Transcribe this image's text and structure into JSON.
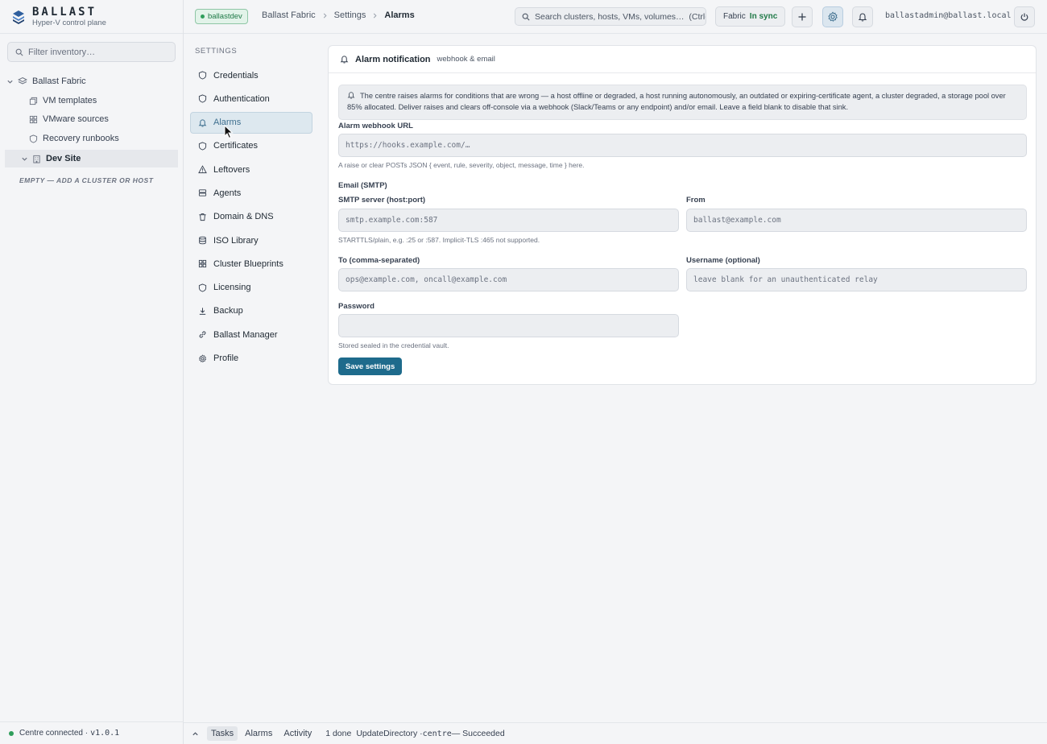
{
  "brand": {
    "name": "BALLAST",
    "subtitle": "Hyper-V control plane"
  },
  "sidebar": {
    "filter_placeholder": "Filter inventory…",
    "tree": [
      {
        "label": "Ballast Fabric",
        "icon": "layers-icon",
        "expanded": true
      },
      {
        "label": "VM templates",
        "icon": "copy-icon"
      },
      {
        "label": "VMware sources",
        "icon": "grid-icon"
      },
      {
        "label": "Recovery runbooks",
        "icon": "shield-icon"
      },
      {
        "label": "Dev Site",
        "icon": "building-icon",
        "expanded": true,
        "selected": true
      }
    ],
    "empty_hint": "EMPTY — ADD A CLUSTER OR HOST",
    "status": "Centre connected · ",
    "version": "v1.0.1"
  },
  "topbar": {
    "env_badge": "ballastdev",
    "breadcrumb": [
      "Ballast Fabric",
      "Settings",
      "Alarms"
    ],
    "search_placeholder": "Search clusters, hosts, VMs, volumes…  (Ctrl-K)",
    "fabric_label": "Fabric",
    "fabric_status": "In sync",
    "user": "ballastadmin@ballast.local"
  },
  "settings_nav": {
    "title": "SETTINGS",
    "items": [
      {
        "label": "Credentials",
        "icon": "shield-icon"
      },
      {
        "label": "Authentication",
        "icon": "shield-icon"
      },
      {
        "label": "Alarms",
        "icon": "bell-icon",
        "active": true
      },
      {
        "label": "Certificates",
        "icon": "shield-icon"
      },
      {
        "label": "Leftovers",
        "icon": "warning-icon"
      },
      {
        "label": "Agents",
        "icon": "server-icon"
      },
      {
        "label": "Domain & DNS",
        "icon": "trash-icon"
      },
      {
        "label": "ISO Library",
        "icon": "database-icon"
      },
      {
        "label": "Cluster Blueprints",
        "icon": "grid-icon"
      },
      {
        "label": "Licensing",
        "icon": "shield-icon"
      },
      {
        "label": "Backup",
        "icon": "download-icon"
      },
      {
        "label": "Ballast Manager",
        "icon": "link-icon"
      },
      {
        "label": "Profile",
        "icon": "gear-icon"
      }
    ]
  },
  "card": {
    "title": "Alarm notification",
    "subtitle": "webhook & email",
    "info": "The centre raises alarms for conditions that are wrong — a host offline or degraded, a host running autonomously, an outdated or expiring-certificate agent, a cluster degraded, a storage pool over 85% allocated. Deliver raises and clears off-console via a webhook (Slack/Teams or any endpoint) and/or email. Leave a field blank to disable that sink.",
    "webhook": {
      "label": "Alarm webhook URL",
      "placeholder": "https://hooks.example.com/…",
      "value": "",
      "hint": "A raise or clear POSTs JSON { event, rule, severity, object, message, time } here."
    },
    "email_section": "Email (SMTP)",
    "smtp": {
      "label": "SMTP server (host:port)",
      "placeholder": "smtp.example.com:587",
      "value": "",
      "hint": "STARTTLS/plain, e.g. :25 or :587. Implicit-TLS :465 not supported."
    },
    "from": {
      "label": "From",
      "placeholder": "ballast@example.com",
      "value": ""
    },
    "to": {
      "label": "To (comma-separated)",
      "placeholder": "ops@example.com, oncall@example.com",
      "value": ""
    },
    "username": {
      "label": "Username (optional)",
      "placeholder": "leave blank for an unauthenticated relay",
      "value": ""
    },
    "password": {
      "label": "Password",
      "placeholder": "",
      "value": "",
      "hint": "Stored sealed in the credential vault."
    },
    "save_label": "Save settings"
  },
  "bottombar": {
    "tabs": [
      "Tasks",
      "Alarms",
      "Activity"
    ],
    "active_tab": "Tasks",
    "task_count": "1 done",
    "task_name": "UpdateDirectory · ",
    "task_target": "centre",
    "task_result": " — Succeeded"
  },
  "colors": {
    "accent": "#1e6b8c",
    "success": "#2f9e5b",
    "active_nav_bg": "#dde8ef",
    "active_nav_text": "#3e6f8f"
  }
}
